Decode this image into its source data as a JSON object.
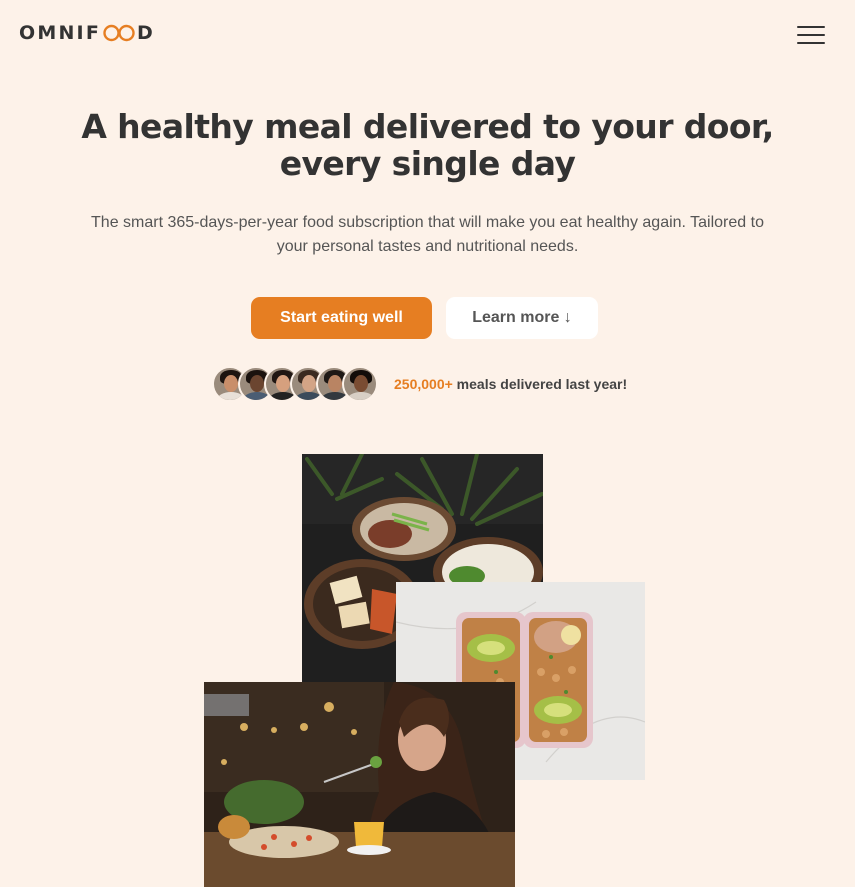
{
  "header": {
    "logo_text_start": "OMNIF",
    "logo_text_end": "D",
    "logo_icon": "infinity-oo-icon",
    "menu_icon": "hamburger-menu-icon"
  },
  "hero": {
    "title_line1": "A healthy meal delivered to your door,",
    "title_line2": "every single day",
    "subtitle_line1": "The smart 365-days-per-year food subscription that will make you eat healthy again. Tailored to",
    "subtitle_line2": "your personal tastes and nutritional needs.",
    "primary_button": "Start eating well",
    "secondary_button": "Learn more ↓"
  },
  "delivered": {
    "count": "250,000+",
    "text": " meals delivered last year!",
    "avatars": [
      {
        "name": "customer-1",
        "skin": "#c98e6a",
        "hair": "#1d1410",
        "shirt": "#e8e0d8"
      },
      {
        "name": "customer-2",
        "skin": "#6b4530",
        "hair": "#1a120e",
        "shirt": "#4a5d73"
      },
      {
        "name": "customer-3",
        "skin": "#d6a07e",
        "hair": "#201612",
        "shirt": "#222"
      },
      {
        "name": "customer-4",
        "skin": "#d3a486",
        "hair": "#3a2a20",
        "shirt": "#3b4b5b"
      },
      {
        "name": "customer-5",
        "skin": "#b98463",
        "hair": "#1e1815",
        "shirt": "#33393f"
      },
      {
        "name": "customer-6",
        "skin": "#7a4c32",
        "hair": "#120c09",
        "shirt": "#d8cfc5"
      }
    ]
  },
  "colors": {
    "background": "#fdf2e9",
    "accent": "#e67e22",
    "text": "#333333"
  }
}
